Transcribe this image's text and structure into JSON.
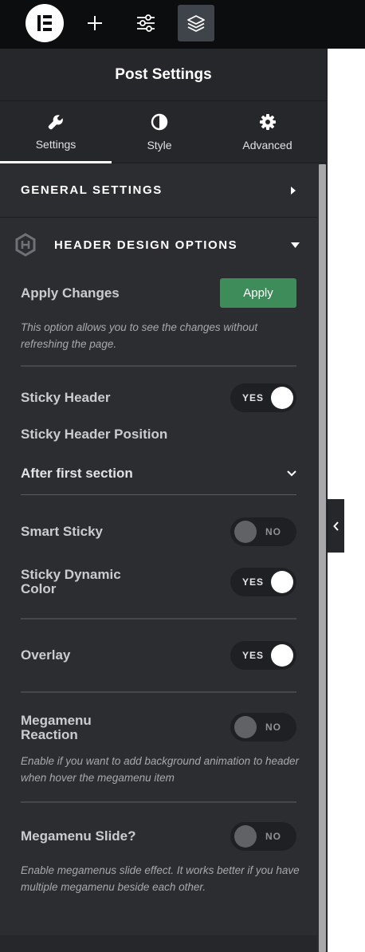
{
  "topbar": {
    "logo_icon": "elementor-logo-icon",
    "buttons": [
      {
        "icon": "plus-icon"
      },
      {
        "icon": "sliders-icon"
      },
      {
        "icon": "layers-icon",
        "active": true
      }
    ]
  },
  "panel": {
    "title": "Post Settings",
    "tabs": [
      {
        "label": "Settings",
        "icon": "wrench-icon",
        "active": true
      },
      {
        "label": "Style",
        "icon": "contrast-icon"
      },
      {
        "label": "Advanced",
        "icon": "gear-icon"
      }
    ]
  },
  "general_settings": {
    "title": "GENERAL SETTINGS"
  },
  "header_design": {
    "title": "HEADER DESIGN OPTIONS",
    "apply_label": "Apply Changes",
    "apply_button": "Apply",
    "apply_description": "This option allows you to see the changes without refreshing the page.",
    "sticky_header": {
      "label": "Sticky Header",
      "value": "YES"
    },
    "sticky_position": {
      "label": "Sticky Header Position",
      "value": "After first section"
    },
    "smart_sticky": {
      "label": "Smart Sticky",
      "value": "NO"
    },
    "sticky_dynamic_color": {
      "label_line1": "Sticky Dynamic",
      "label_line2": "Color",
      "value": "YES"
    },
    "overlay": {
      "label": "Overlay",
      "value": "YES"
    },
    "megamenu_reaction": {
      "label_line1": "Megamenu",
      "label_line2": "Reaction",
      "value": "NO",
      "description": "Enable if you want to add background animation to header when hover the megamenu item"
    },
    "megamenu_slide": {
      "label": "Megamenu Slide?",
      "value": "NO",
      "description": "Enable megamenus slide effect. It works better if you have multiple megamenu beside each other."
    }
  },
  "colors": {
    "panel_bg": "#2c2d31",
    "apply_green": "#3e8c5a"
  }
}
